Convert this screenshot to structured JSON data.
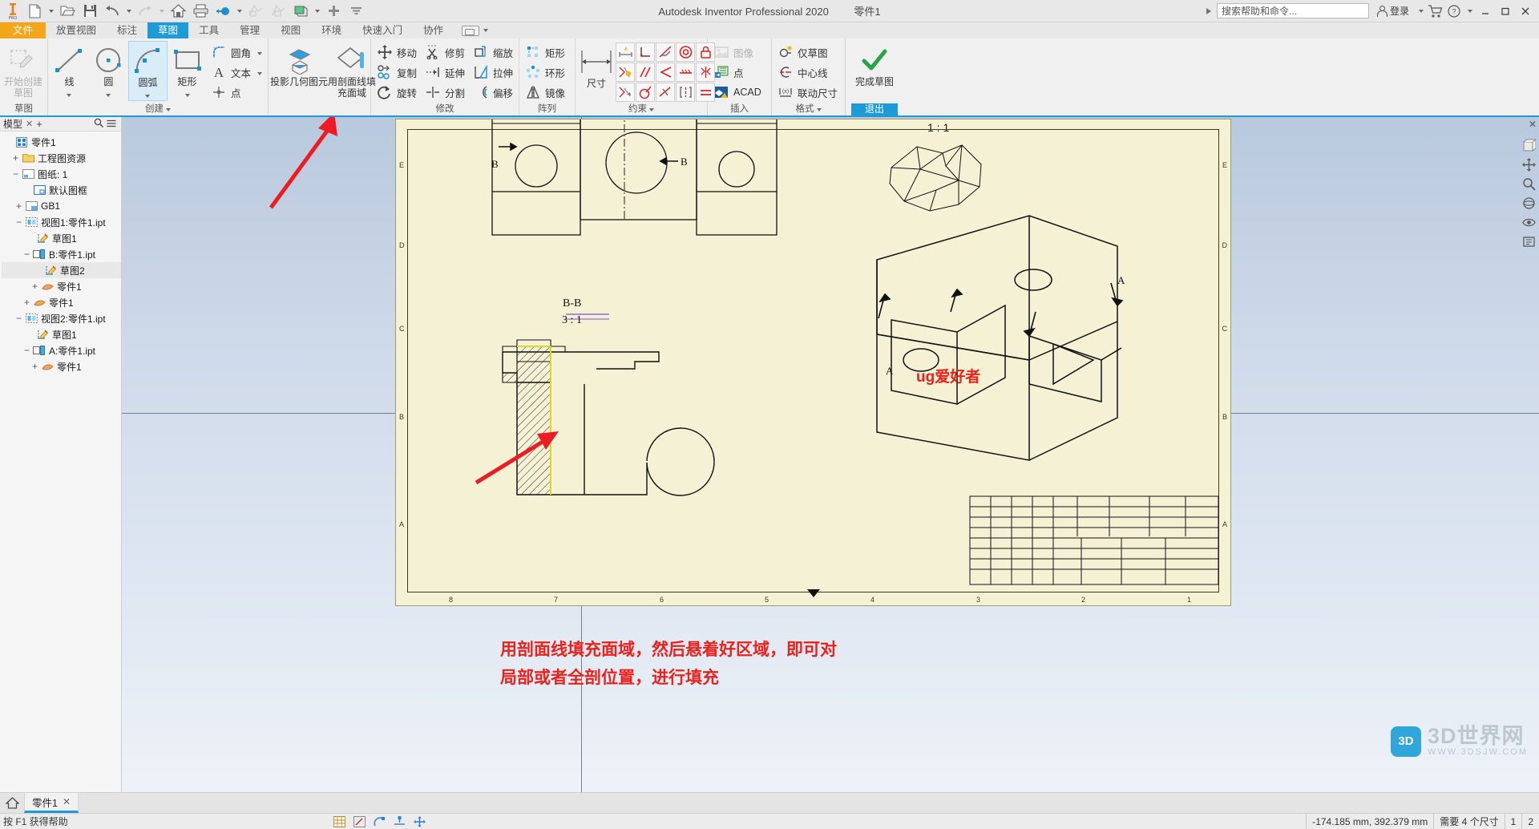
{
  "titlebar": {
    "app_title": "Autodesk Inventor Professional 2020",
    "document_name": "零件1",
    "search_placeholder": "搜索帮助和命令...",
    "signin_label": "登录",
    "quick_access": [
      {
        "name": "new-file-icon",
        "label": "新建"
      },
      {
        "name": "open-file-icon",
        "label": "打开"
      },
      {
        "name": "save-icon",
        "label": "保存"
      },
      {
        "name": "undo-icon",
        "label": "撤消"
      },
      {
        "name": "redo-icon",
        "label": "重做"
      },
      {
        "name": "home-icon",
        "label": "主页"
      },
      {
        "name": "print-icon",
        "label": "打印"
      },
      {
        "name": "select-icon",
        "label": "选择"
      },
      {
        "name": "update-icon",
        "label": "更新"
      },
      {
        "name": "update2-icon",
        "label": "更新2"
      },
      {
        "name": "appearance-icon",
        "label": "外观"
      },
      {
        "name": "add-icon",
        "label": "添加"
      },
      {
        "name": "more-icon",
        "label": "更多"
      }
    ],
    "window_buttons": [
      "—",
      "❐",
      "✕"
    ]
  },
  "tabs": [
    {
      "label": "文件",
      "kind": "file"
    },
    {
      "label": "放置视图",
      "kind": "normal"
    },
    {
      "label": "标注",
      "kind": "normal"
    },
    {
      "label": "草图",
      "kind": "active"
    },
    {
      "label": "工具",
      "kind": "normal"
    },
    {
      "label": "管理",
      "kind": "normal"
    },
    {
      "label": "视图",
      "kind": "normal"
    },
    {
      "label": "环境",
      "kind": "normal"
    },
    {
      "label": "快速入门",
      "kind": "normal"
    },
    {
      "label": "协作",
      "kind": "normal"
    }
  ],
  "ribbon": {
    "panels": [
      {
        "title": "草图",
        "big": [
          {
            "label_line1": "开始创建",
            "label_line2": "草图",
            "icon": "start-sketch-icon",
            "disabled": true,
            "selected": false
          }
        ]
      },
      {
        "title": "创建",
        "title_dropdown": true,
        "big": [
          {
            "label_line1": "线",
            "icon": "line-icon",
            "dropdown": true,
            "selected": false
          },
          {
            "label_line1": "圆",
            "icon": "circle-icon",
            "dropdown": true,
            "selected": false
          },
          {
            "label_line1": "圆弧",
            "icon": "arc-icon",
            "dropdown": true,
            "selected": true
          },
          {
            "label_line1": "矩形",
            "icon": "rectangle-icon",
            "dropdown": true,
            "selected": false
          }
        ],
        "small": [
          {
            "label": "圆角",
            "icon": "fillet-icon",
            "dropdown": true
          },
          {
            "label": "文本",
            "icon": "text-icon",
            "dropdown": true
          },
          {
            "label": "点",
            "icon": "point-icon",
            "dropdown": false
          }
        ]
      },
      {
        "title": "",
        "big2": [
          {
            "label_line1": "投影几何图元",
            "icon": "project-geometry-icon"
          },
          {
            "label_line1": "用剖面线填",
            "label_line2": "充面域",
            "icon": "hatch-fill-icon"
          }
        ]
      },
      {
        "title": "修改",
        "small_grid": [
          [
            "移动",
            "修剪",
            "缩放"
          ],
          [
            "复制",
            "延伸",
            "拉伸"
          ],
          [
            "旋转",
            "分割",
            "偏移"
          ]
        ],
        "icons": [
          [
            "move-icon",
            "trim-icon",
            "scale-icon"
          ],
          [
            "copy-icon",
            "extend-icon",
            "stretch-icon"
          ],
          [
            "rotate-icon",
            "split-icon",
            "offset-icon"
          ]
        ]
      },
      {
        "title": "阵列",
        "small_grid": [
          [
            "矩形"
          ],
          [
            "环形"
          ],
          [
            "镜像"
          ]
        ],
        "icons": [
          [
            "rect-pattern-icon"
          ],
          [
            "circular-pattern-icon"
          ],
          [
            "mirror-icon"
          ]
        ]
      },
      {
        "title": "约束",
        "title_dropdown": true,
        "dim_label": "尺寸",
        "constraint_icons": [
          [
            "auto-dim-icon",
            "perpendicular-icon",
            "tangent-icon",
            "concentric-icon",
            "fix-icon"
          ],
          [
            "show-constraints-icon",
            "parallel-icon",
            "coincident-icon",
            "collinear-icon",
            "symmetric-icon"
          ],
          [
            "auto-constrain-icon",
            "equal-radius-icon",
            "smooth-icon",
            "vertical-icon",
            "equal-icon"
          ]
        ]
      },
      {
        "title": "插入",
        "small": [
          {
            "label": "图像",
            "icon": "image-icon",
            "disabled": true
          },
          {
            "label": "点",
            "icon": "insert-point-icon",
            "disabled": false
          },
          {
            "label": "ACAD",
            "icon": "acad-icon",
            "disabled": false
          }
        ]
      },
      {
        "title": "格式",
        "title_dropdown": true,
        "small": [
          {
            "label": "仅草图",
            "icon": "sketch-only-icon"
          },
          {
            "label": "中心线",
            "icon": "centerline-icon"
          },
          {
            "label": "联动尺寸",
            "icon": "driven-dimension-icon"
          }
        ]
      },
      {
        "title": "退出",
        "finish_label_line1": "完成草图",
        "finish_icon": "checkmark-icon",
        "exit_tag": "退出"
      }
    ]
  },
  "browser": {
    "tab_label": "模型",
    "close_label": "✕",
    "add_label": "+",
    "search_icon": "search-icon",
    "menu_icon": "hamburger-icon",
    "tree": [
      {
        "depth": 0,
        "label": "零件1",
        "expander": "",
        "icon": "assembly-icon",
        "selected": false
      },
      {
        "depth": 1,
        "label": "工程图资源",
        "expander": "+",
        "icon": "folder-icon",
        "selected": false
      },
      {
        "depth": 1,
        "label": "图纸: 1",
        "expander": "−",
        "icon": "sheet-icon",
        "selected": false
      },
      {
        "depth": 2,
        "label": "默认图框",
        "expander": "",
        "icon": "border-icon",
        "selected": false
      },
      {
        "depth": 2,
        "label": "GB1",
        "expander": "+",
        "icon": "titleblock-icon",
        "selected": false
      },
      {
        "depth": 2,
        "label": "视图1:零件1.ipt",
        "expander": "−",
        "icon": "view-icon",
        "selected": false
      },
      {
        "depth": 3,
        "label": "草图1",
        "expander": "",
        "icon": "sketch-icon",
        "selected": false
      },
      {
        "depth": 3,
        "label": "B:零件1.ipt",
        "expander": "−",
        "icon": "section-view-icon",
        "selected": false
      },
      {
        "depth": 4,
        "label": "草图2",
        "expander": "",
        "icon": "sketch-icon",
        "selected": true
      },
      {
        "depth": 4,
        "label": "零件1",
        "expander": "+",
        "icon": "part-icon",
        "selected": false
      },
      {
        "depth": 3,
        "label": "零件1",
        "expander": "+",
        "icon": "part-icon",
        "selected": false
      },
      {
        "depth": 2,
        "label": "视图2:零件1.ipt",
        "expander": "−",
        "icon": "view-icon",
        "selected": false
      },
      {
        "depth": 3,
        "label": "草图1",
        "expander": "",
        "icon": "sketch-icon",
        "selected": false
      },
      {
        "depth": 3,
        "label": "A:零件1.ipt",
        "expander": "−",
        "icon": "section-view-icon",
        "selected": false
      },
      {
        "depth": 4,
        "label": "零件1",
        "expander": "+",
        "icon": "part-icon",
        "selected": false
      }
    ]
  },
  "canvas": {
    "scale_label": "1 : 1",
    "section_label_top": "B-B",
    "section_label_bottom": "3 : 1",
    "annotation_ug": "ug爱好者",
    "annotation_line1": "用剖面线填充面域，然后悬着好区域，即可对",
    "annotation_line2": "局部或者全剖位置，进行填充",
    "section_marks": [
      "B",
      "B",
      "A",
      "A"
    ],
    "ruler_numbers": [
      "8",
      "7",
      "6",
      "5",
      "4",
      "3",
      "2",
      "1"
    ],
    "zone_letters_left": [
      "E",
      "D",
      "C",
      "B",
      "A"
    ],
    "zone_letters_right": [
      "E",
      "D",
      "C",
      "B",
      "A"
    ],
    "watermark_text": "3D世界网",
    "watermark_sub": "WWW.3DSJW.COM",
    "watermark_badge": "3D",
    "nav_icons": [
      "viewcube-icon",
      "pan-icon",
      "zoom-icon",
      "orbit-icon",
      "look-at-icon",
      "zoom-all-icon"
    ]
  },
  "doctabs": {
    "home_icon": "home-icon",
    "tabs": [
      {
        "label": "零件1",
        "close": "✕"
      }
    ]
  },
  "statusbar": {
    "help_text": "按 F1 获得帮助",
    "coordinates": "-174.185 mm, 392.379 mm",
    "constraint_status": "需要 4 个尺寸",
    "value1": "1",
    "value2": "2",
    "tool_icons": [
      "grid-icon",
      "snap-icon",
      "constraint-icon",
      "dim-icon",
      "move-icon"
    ]
  },
  "colors": {
    "accent_blue": "#1e9bd7",
    "file_orange": "#f2a71b",
    "annotation_red": "#e8221c",
    "sheet_bg": "#f4f1d5",
    "canvas_bg": "#cfdaea"
  }
}
